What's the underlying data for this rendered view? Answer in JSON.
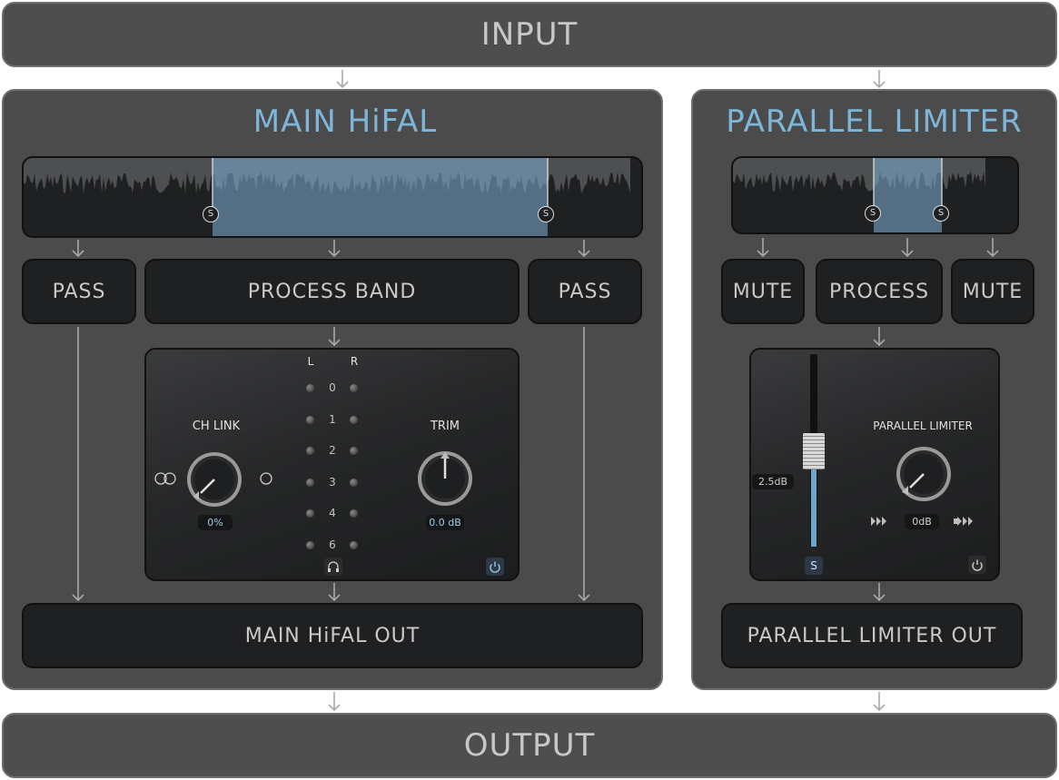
{
  "input_label": "INPUT",
  "output_label": "OUTPUT",
  "main": {
    "title": "MAIN HiFAL",
    "pass_left": "PASS",
    "process_band": "PROCESS BAND",
    "pass_right": "PASS",
    "out_label": "MAIN HiFAL OUT",
    "split_markers": [
      "S",
      "S"
    ],
    "device": {
      "ch_link_label": "CH LINK",
      "ch_link_value": "0%",
      "trim_label": "TRIM",
      "trim_value": "0.0 dB",
      "meter_left": "L",
      "meter_right": "R",
      "meter_scale": [
        "0",
        "1",
        "2",
        "3",
        "4",
        "6"
      ],
      "headphone_icon": "headphones-icon",
      "power_icon": "power-icon"
    }
  },
  "parallel": {
    "title": "PARALLEL LIMITER",
    "mute_left": "MUTE",
    "process": "PROCESS",
    "mute_right": "MUTE",
    "out_label": "PARALLEL LIMITER OUT",
    "split_markers": [
      "S",
      "S"
    ],
    "device": {
      "fader_value": "2.5dB",
      "fader_level": 0.55,
      "solo_label": "S",
      "limiter_label": "PARALLEL LIMITER",
      "limiter_value": "0dB",
      "power_icon": "power-icon"
    }
  },
  "colors": {
    "accent": "#7eb6d9",
    "panel": "#4b4b4b",
    "box": "#1f2021"
  }
}
